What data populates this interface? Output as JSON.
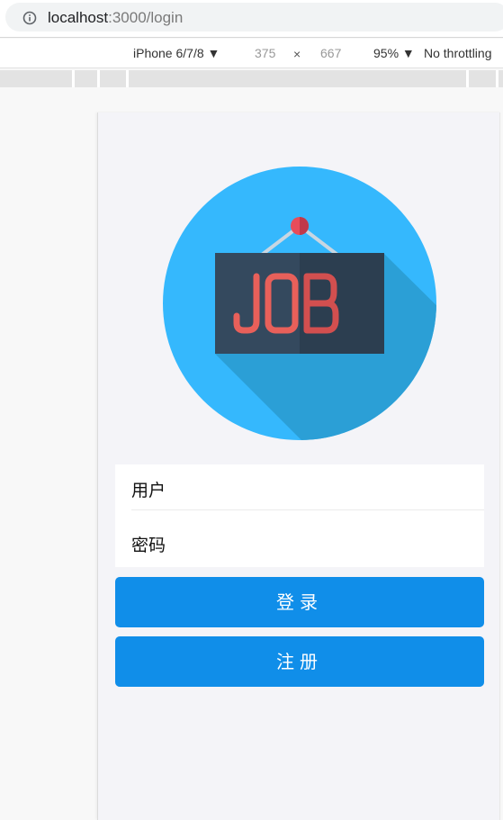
{
  "browser": {
    "url_host": "localhost",
    "url_path": ":3000/login",
    "info_icon": "info-icon"
  },
  "device_toolbar": {
    "device": "iPhone 6/7/8 ▼",
    "width": "375",
    "times": "×",
    "height": "667",
    "zoom": "95% ▼",
    "throttling": "No throttling"
  },
  "app": {
    "logo_text": "JOB",
    "logo_icon": "job-sign-logo",
    "colors": {
      "logo_circle": "#35b8fd",
      "sign_board": "#34495e",
      "sign_text": "#e8605a",
      "pin": "#e74c5a",
      "button": "#108ee9",
      "background": "#f4f4f8"
    },
    "form": {
      "user_label": "用户",
      "password_label": "密码"
    },
    "buttons": {
      "login": "登录",
      "register": "注册"
    }
  }
}
